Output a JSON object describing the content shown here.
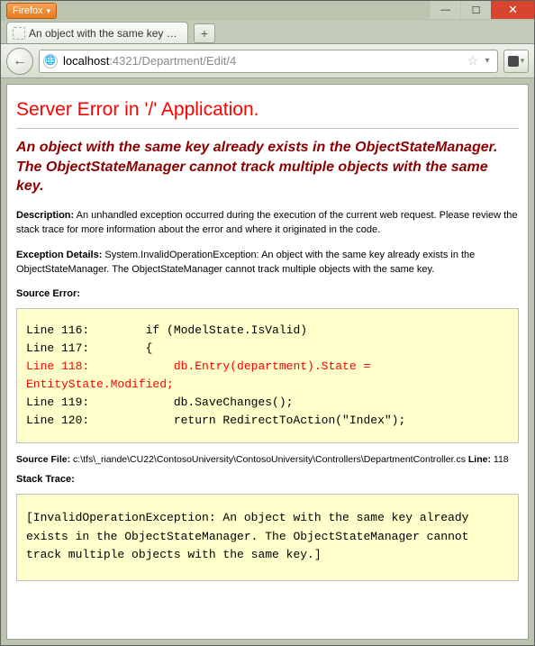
{
  "window": {
    "app_menu_label": "Firefox",
    "min_glyph": "—",
    "max_glyph": "☐",
    "close_glyph": "✕"
  },
  "tabs": {
    "active_title": "An object with the same key already exis...",
    "newtab_glyph": "+"
  },
  "nav": {
    "back_glyph": "←",
    "url_host": "localhost",
    "url_portpath": ":4321/Department/Edit/4",
    "star_glyph": "☆",
    "dd_glyph": "▾"
  },
  "error": {
    "title": "Server Error in '/' Application.",
    "message": "An object with the same key already exists in the ObjectStateManager. The ObjectStateManager cannot track multiple objects with the same key.",
    "description_label": "Description:",
    "description_text": " An unhandled exception occurred during the execution of the current web request. Please review the stack trace for more information about the error and where it originated in the code.",
    "exception_label": "Exception Details:",
    "exception_text": " System.InvalidOperationException: An object with the same key already exists in the ObjectStateManager. The ObjectStateManager cannot track multiple objects with the same key.",
    "source_error_label": "Source Error:",
    "code_pre": "Line 116:        if (ModelState.IsValid)\nLine 117:        {\n",
    "code_hl": "Line 118:            db.Entry(department).State = EntityState.Modified;\n",
    "code_post": "Line 119:            db.SaveChanges();\nLine 120:            return RedirectToAction(\"Index\");",
    "source_file_label": "Source File:",
    "source_file_text": " c:\\tfs\\_riande\\CU22\\ContosoUniversity\\ContosoUniversity\\Controllers\\DepartmentController.cs    ",
    "line_label": "Line:",
    "line_text": " 118",
    "stack_trace_label": "Stack Trace:",
    "stack_trace_text": "[InvalidOperationException: An object with the same key already exists in the ObjectStateManager. The ObjectStateManager cannot track multiple objects with the same key.]"
  }
}
